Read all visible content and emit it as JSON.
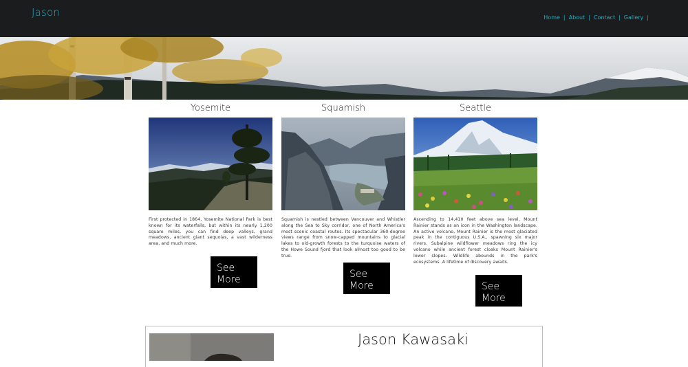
{
  "header": {
    "brand": "Jason",
    "nav": [
      "Home",
      "About",
      "Contact",
      "Gallery"
    ],
    "separator": "|"
  },
  "hero": {
    "alt": "mountain landscape with autumn birch trees"
  },
  "cards": [
    {
      "title": "Yosemite",
      "description": "First protected in 1864, Yosemite National Park is best known for its waterfalls, but within its nearly 1,200 square miles, you can find deep valleys, grand meadows, ancient giant sequoias, a vast wilderness area, and much more.",
      "button": "See More"
    },
    {
      "title": "Squamish",
      "description": "Squamish is nestled between Vancouver and Whistler along the Sea to Sky corridor, one of North America's most scenic coastal routes. Its spectacular 360-degree views range from snow-capped mountains to glacial lakes to old-growth forests to the turquoise waters of the Howe Sound fjord that look almost too good to be true.",
      "button": "See More"
    },
    {
      "title": "Seattle",
      "description": "Ascending to 14,410 feet above sea level, Mount Rainier stands as an icon in the Washington landscape. An active volcano, Mount Rainier is the most glaciated peak in the contiguous U.S.A., spawning six major rivers. Subalpine wildflower meadows ring the icy volcano while ancient forest cloaks Mount Rainier's lower slopes. Wildlife abounds in the park's ecosystems. A lifetime of discovery awaits.",
      "button": "See More"
    }
  ],
  "about": {
    "name": "Jason Kawasaki"
  },
  "colors": {
    "header_bg": "#1b1c1d",
    "accent": "#1ab0c9",
    "button_bg": "#000000"
  }
}
